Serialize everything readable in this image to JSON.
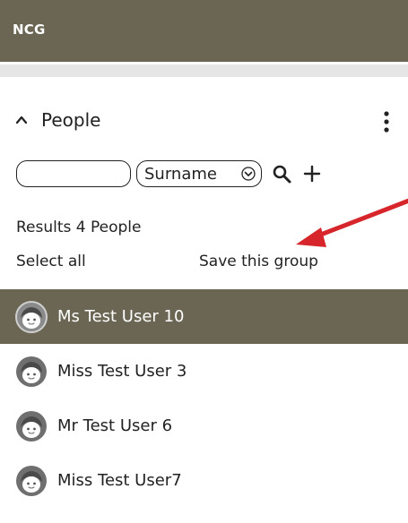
{
  "app": {
    "title": "NCG"
  },
  "section": {
    "title": "People"
  },
  "search": {
    "value": "",
    "placeholder": "",
    "sort_selected": "Surname"
  },
  "results": {
    "label": "Results 4 People",
    "select_all": "Select all",
    "save_group": "Save this group"
  },
  "people": [
    {
      "name": "Ms Test User 10",
      "selected": true
    },
    {
      "name": "Miss Test User 3",
      "selected": false
    },
    {
      "name": "Mr Test User 6",
      "selected": false
    },
    {
      "name": "Miss Test User7",
      "selected": false
    }
  ],
  "colors": {
    "header_bg": "#6b6654",
    "selected_bg": "#6b6654",
    "arrow": "#d7262b",
    "avatar_bg": "#6f6f6f"
  },
  "icons": {
    "section_toggle": "chevron-up-icon",
    "menu": "kebab-icon",
    "search": "search-icon",
    "add": "plus-icon",
    "sort_caret": "chevron-down-icon",
    "person": "avatar-face-icon"
  }
}
